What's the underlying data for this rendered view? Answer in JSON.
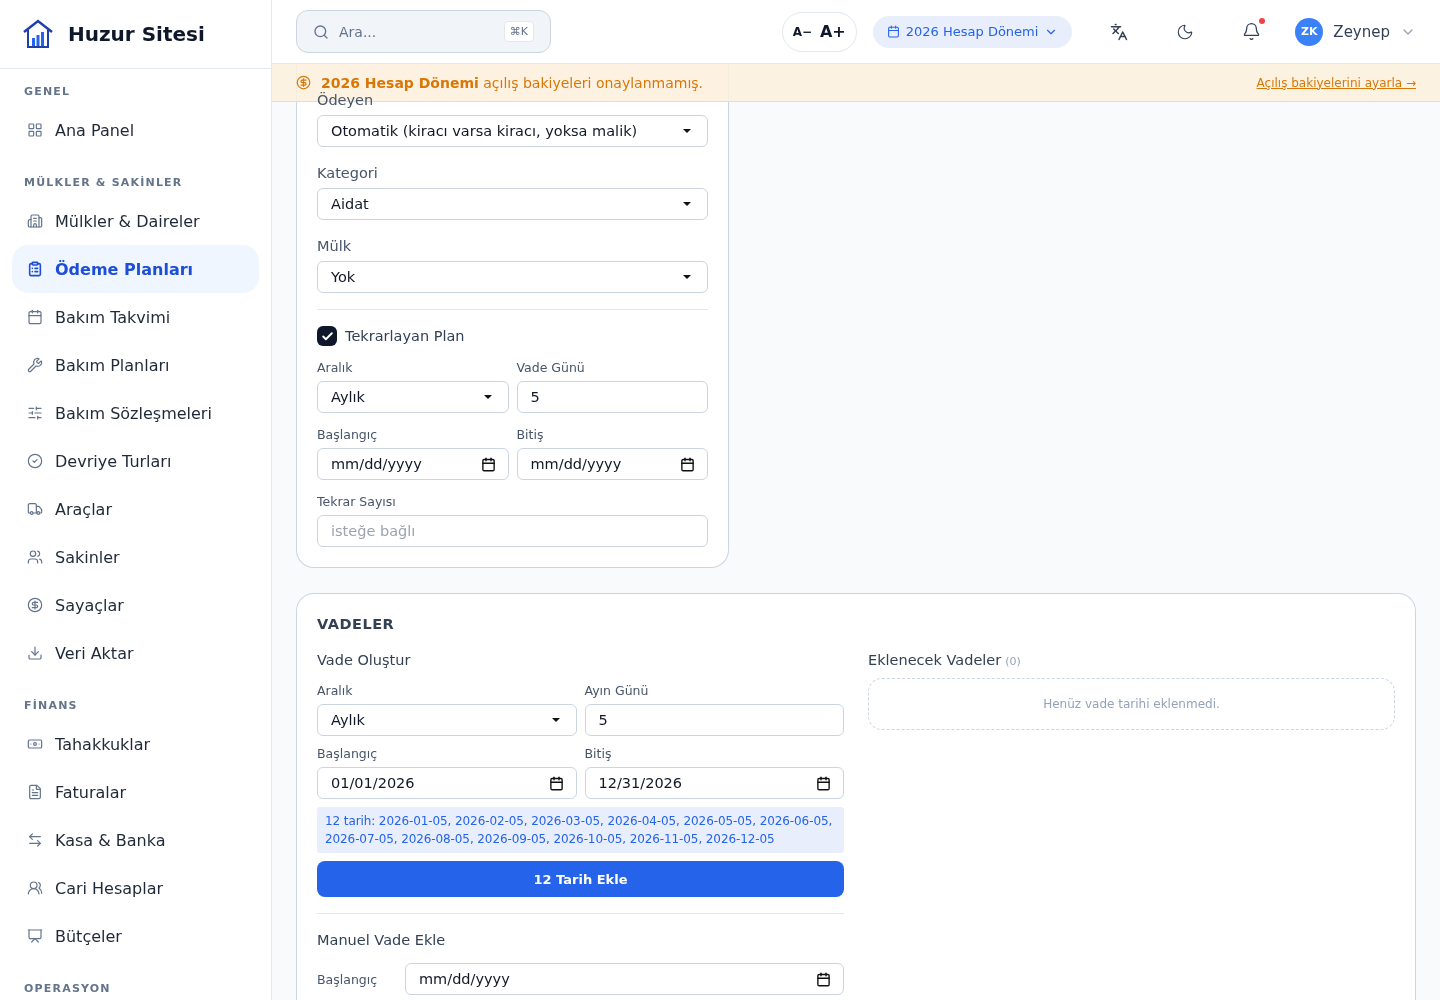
{
  "brand": {
    "name": "Huzur Sitesi"
  },
  "sidebar": {
    "sections": [
      {
        "title": "GENEL",
        "items": [
          {
            "label": "Ana Panel",
            "selected": false
          }
        ]
      },
      {
        "title": "MÜLKLER & SAKİNLER",
        "items": [
          {
            "label": "Mülkler & Daireler",
            "selected": false
          },
          {
            "label": "Ödeme Planları",
            "selected": true
          },
          {
            "label": "Bakım Takvimi",
            "selected": false
          },
          {
            "label": "Bakım Planları",
            "selected": false
          },
          {
            "label": "Bakım Sözleşmeleri",
            "selected": false
          },
          {
            "label": "Devriye Turları",
            "selected": false
          },
          {
            "label": "Araçlar",
            "selected": false
          },
          {
            "label": "Sakinler",
            "selected": false
          },
          {
            "label": "Sayaçlar",
            "selected": false
          },
          {
            "label": "Veri Aktar",
            "selected": false
          }
        ]
      },
      {
        "title": "FİNANS",
        "items": [
          {
            "label": "Tahakkuklar",
            "selected": false
          },
          {
            "label": "Faturalar",
            "selected": false
          },
          {
            "label": "Kasa & Banka",
            "selected": false
          },
          {
            "label": "Cari Hesaplar",
            "selected": false
          },
          {
            "label": "Bütçeler",
            "selected": false
          }
        ]
      },
      {
        "title": "OPERASYON"
      }
    ]
  },
  "topbar": {
    "search": {
      "placeholder": "Ara...",
      "shortcut": "⌘K"
    },
    "font_size": {
      "decrease": "A−",
      "increase": "A+"
    },
    "period": "2026 Hesap Dönemi",
    "notifications": {
      "unread": true
    },
    "user": {
      "initials": "ZK",
      "name": "Zeynep"
    }
  },
  "banner": {
    "message": "**2026 Hesap Dönemi** açılış bakiyeleri onaylanmamış.",
    "link": "Açılış bakiyelerini ayarla →"
  },
  "plan_form": {
    "fields": [
      {
        "label": "Ödeyen",
        "value": "Otomatik (kiracı varsa kiracı, yoksa malik)",
        "kind": "select"
      },
      {
        "label": "Kategori",
        "value": "Aidat",
        "kind": "select"
      },
      {
        "label": "Mülk",
        "value": "Yok",
        "kind": "select"
      }
    ],
    "recurring": {
      "label": "Tekrarlayan Plan",
      "checked": true,
      "fields": [
        {
          "label": "Aralık",
          "value": "Aylık",
          "kind": "select"
        },
        {
          "label": "Vade Günü",
          "value": "5",
          "kind": "text"
        },
        {
          "label": "Başlangıç",
          "value": "mm/dd/yyyy",
          "kind": "date"
        },
        {
          "label": "Bitiş",
          "value": "mm/dd/yyyy",
          "kind": "date"
        },
        {
          "label": "Tekrar Sayısı",
          "placeholder": "isteğe bağlı",
          "kind": "text",
          "wide": true
        }
      ]
    }
  },
  "dues": {
    "title": "VADELER",
    "generator": {
      "title": "Vade Oluştur",
      "fields": [
        {
          "label": "Aralık",
          "value": "Aylık",
          "kind": "select"
        },
        {
          "label": "Ayın Günü",
          "value": "5",
          "kind": "text"
        },
        {
          "label": "Başlangıç",
          "value": "01/01/2026",
          "kind": "date"
        },
        {
          "label": "Bitiş",
          "value": "12/31/2026",
          "kind": "date"
        }
      ],
      "preview": "12 tarih: 2026-01-05, 2026-02-05, 2026-03-05, 2026-04-05, 2026-05-05, 2026-06-05, 2026-07-05, 2026-08-05, 2026-09-05, 2026-10-05, 2026-11-05, 2026-12-05",
      "button": "12 Tarih Ekle"
    },
    "manual": {
      "title": "Manuel Vade Ekle",
      "fields": [
        {
          "label": "Başlangıç",
          "value": "mm/dd/yyyy",
          "kind": "date"
        }
      ]
    },
    "pending": {
      "title": "Eklenecek Vadeler",
      "count": "(0)",
      "empty": "Henüz vade tarihi eklenmedi."
    }
  }
}
